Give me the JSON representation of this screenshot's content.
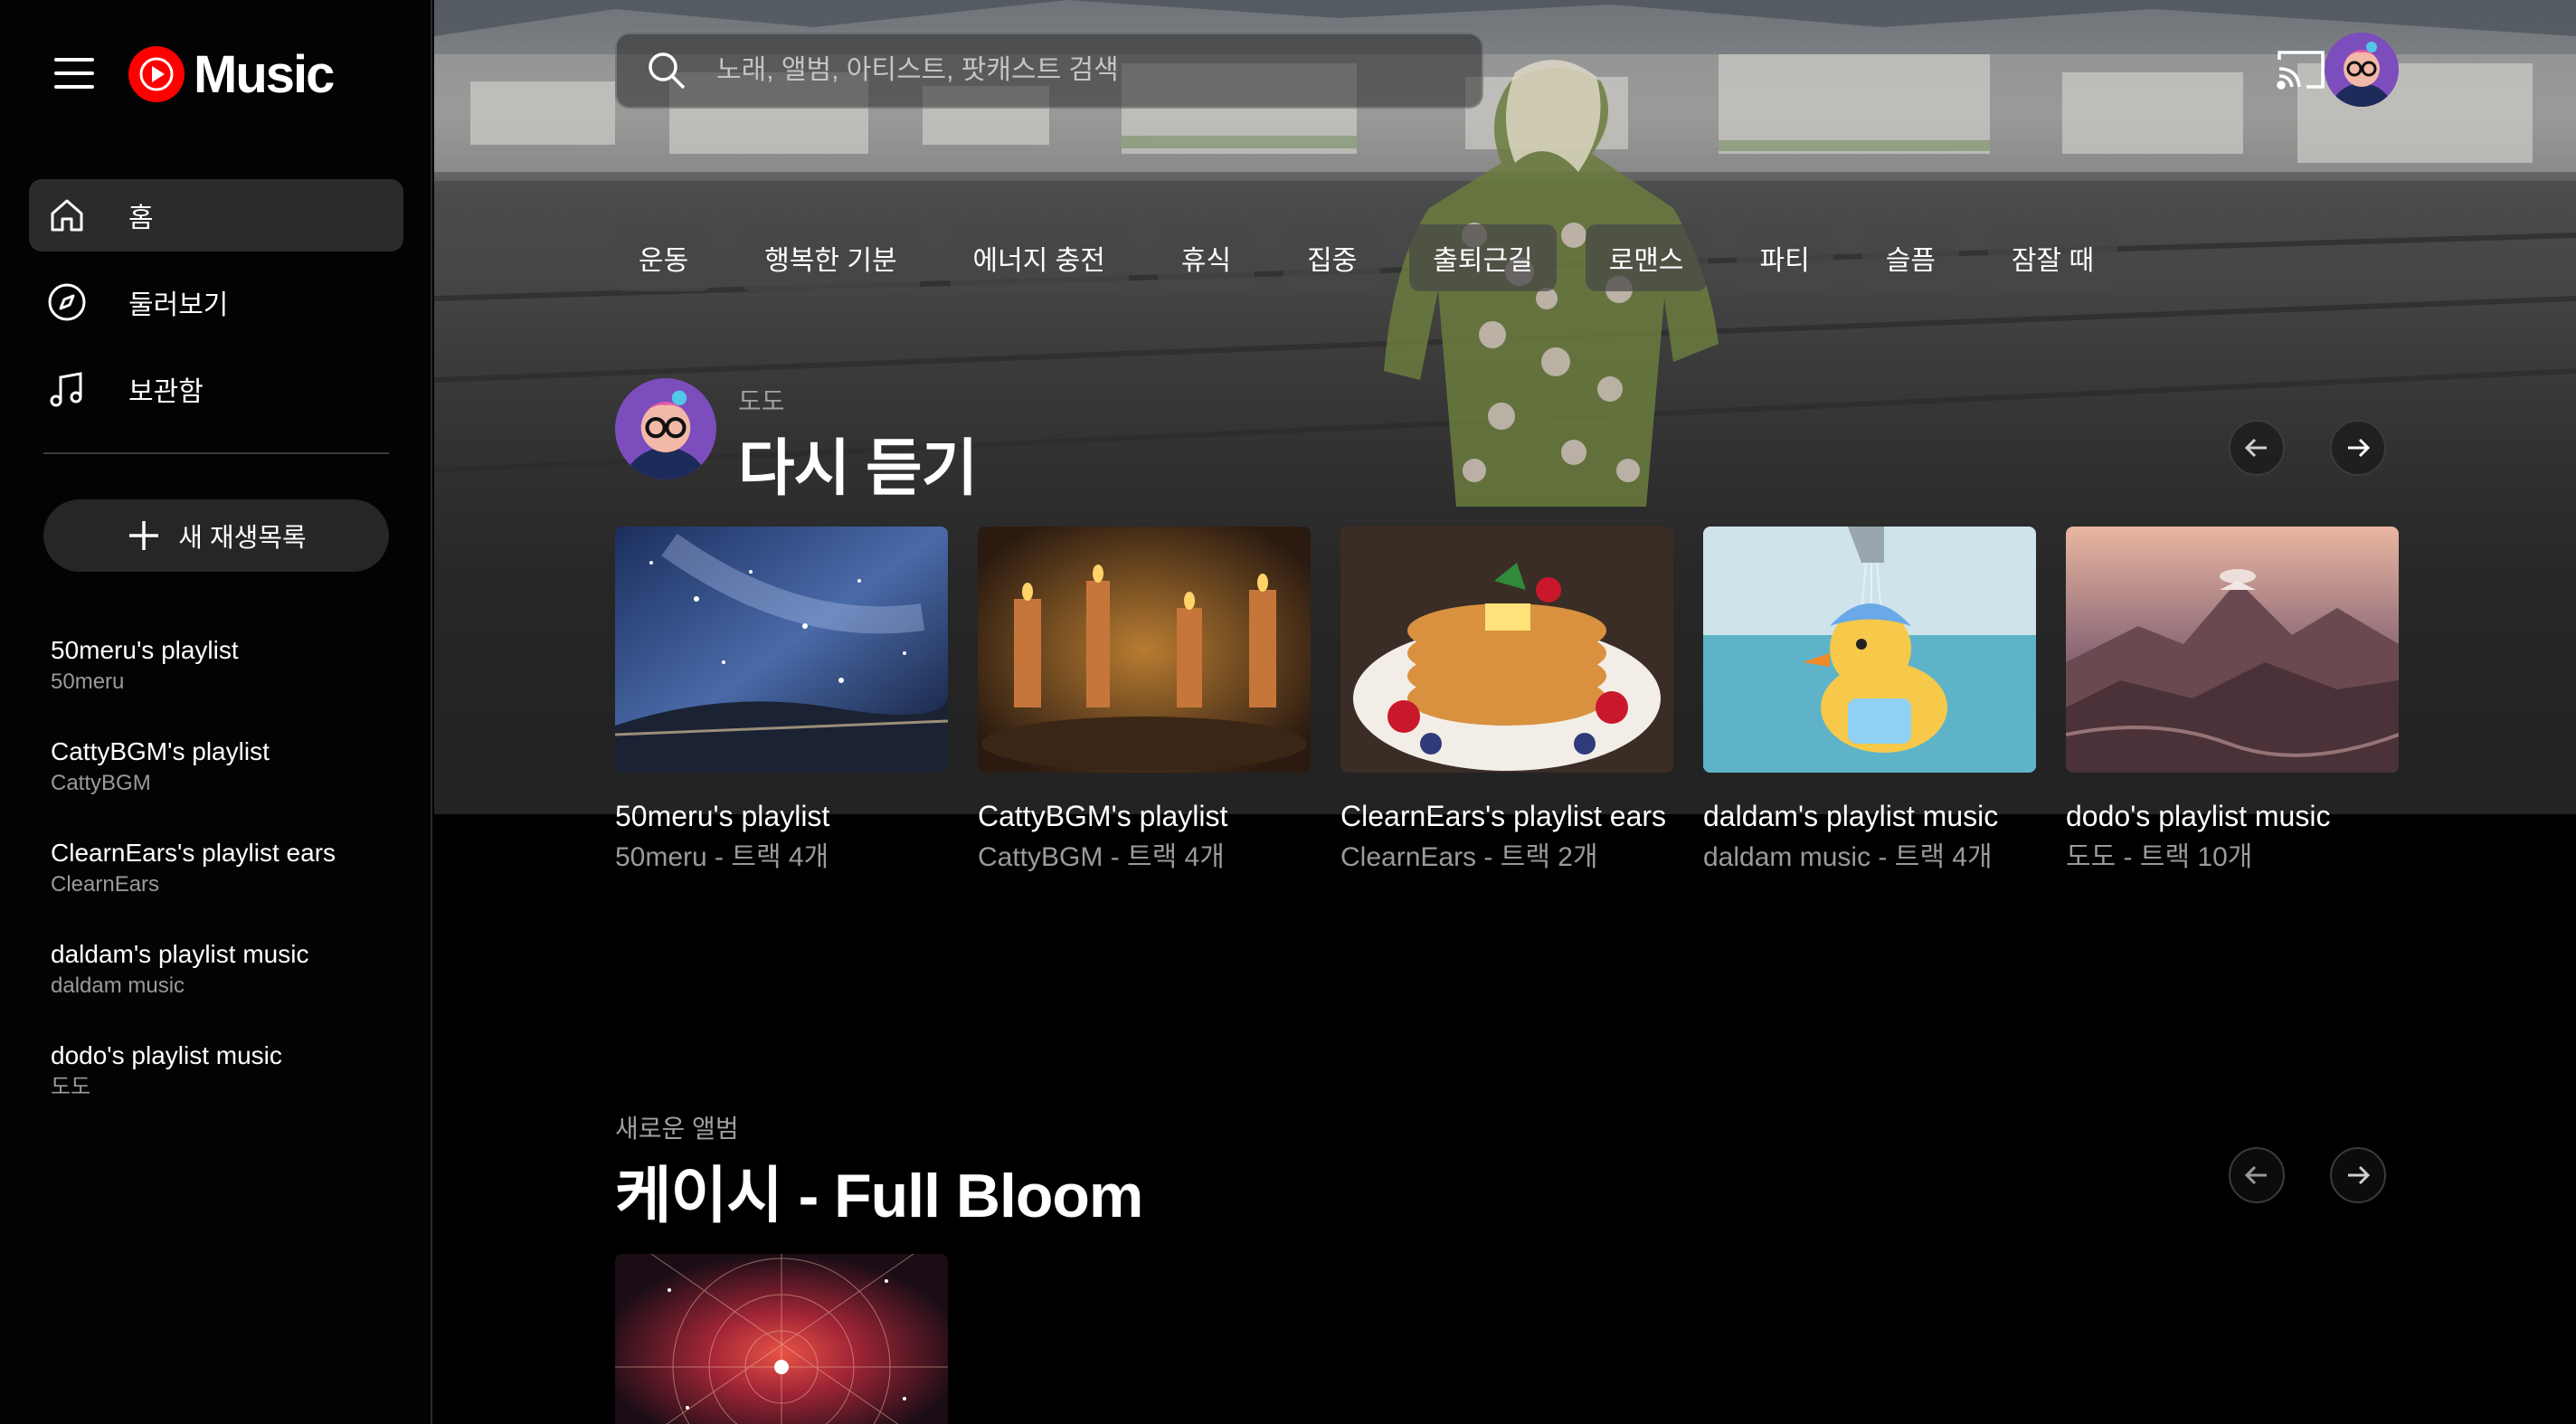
{
  "app": {
    "logo_text": "Music"
  },
  "sidebar": {
    "nav": [
      {
        "label": "홈",
        "icon": "home-icon",
        "active": true
      },
      {
        "label": "둘러보기",
        "icon": "explore-compass-icon",
        "active": false
      },
      {
        "label": "보관함",
        "icon": "library-music-note-icon",
        "active": false
      }
    ],
    "new_playlist_label": "새 재생목록",
    "playlists": [
      {
        "title": "50meru's playlist",
        "owner": "50meru"
      },
      {
        "title": "CattyBGM's playlist",
        "owner": "CattyBGM"
      },
      {
        "title": "ClearnEars's playlist ears",
        "owner": "ClearnEars"
      },
      {
        "title": "daldam's playlist music",
        "owner": "daldam music"
      },
      {
        "title": "dodo's playlist music",
        "owner": "도도"
      }
    ]
  },
  "header": {
    "search_placeholder": "노래, 앨범, 아티스트, 팟캐스트 검색"
  },
  "chips": [
    "운동",
    "행복한 기분",
    "에너지 충전",
    "휴식",
    "집중",
    "출퇴근길",
    "로맨스",
    "파티",
    "슬픔",
    "잠잘 때"
  ],
  "listen_again": {
    "subtitle": "도도",
    "title": "다시 듣기",
    "cards": [
      {
        "title": "50meru's playlist",
        "subtitle": "50meru - 트랙 4개"
      },
      {
        "title": "CattyBGM's playlist",
        "subtitle": "CattyBGM - 트랙 4개"
      },
      {
        "title": "ClearnEars's playlist ears",
        "subtitle": "ClearnEars - 트랙 2개"
      },
      {
        "title": "daldam's playlist music",
        "subtitle": "daldam music - 트랙 4개"
      },
      {
        "title": "dodo's playlist music",
        "subtitle": "도도 - 트랙 10개"
      }
    ]
  },
  "new_album": {
    "subtitle": "새로운 앨범",
    "title": "케이시 - Full Bloom"
  },
  "colors": {
    "brand_red": "#ff0000",
    "background": "#000000",
    "sidebar_active": "#2b2b2b",
    "secondary_text": "#9a9a9a"
  }
}
